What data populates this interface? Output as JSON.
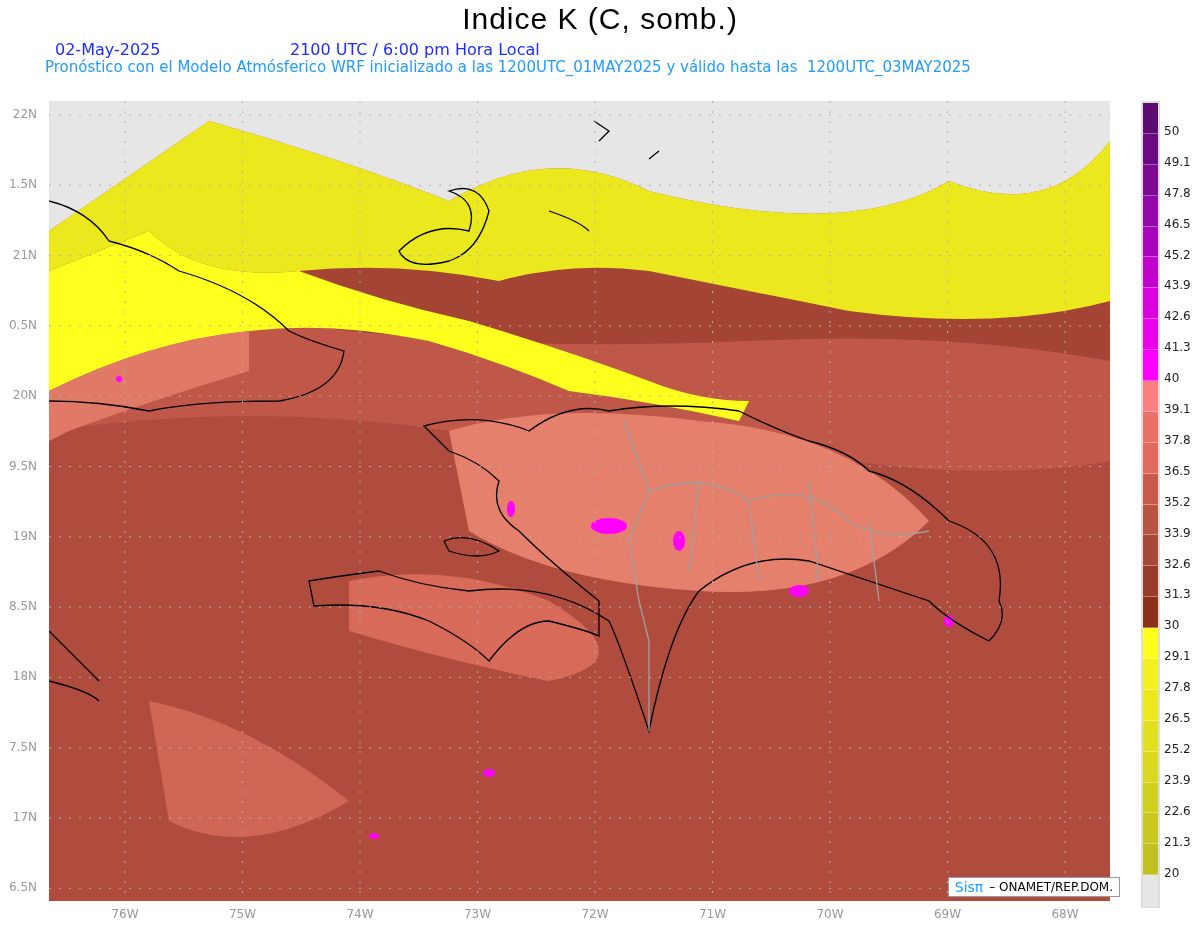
{
  "title": "Indice K (C, somb.)",
  "date": "02-May-2025",
  "time": "2100 UTC / 6:00 pm Hora Local",
  "subtitle": "Pronóstico con el Modelo Atmósferico WRF inicializado a las 1200UTC_01MAY2025 y válido hasta las  1200UTC_03MAY2025",
  "lat_labels": [
    "22N",
    "1.5N",
    "21N",
    "0.5N",
    "20N",
    "9.5N",
    "19N",
    "8.5N",
    "18N",
    "7.5N",
    "17N",
    "6.5N"
  ],
  "lon_labels": [
    "76W",
    "75W",
    "74W",
    "73W",
    "72W",
    "71W",
    "70W",
    "69W",
    "68W"
  ],
  "legend": [
    {
      "label": "50",
      "color": "#5e0d6e"
    },
    {
      "label": "49.1",
      "color": "#6b0b80"
    },
    {
      "label": "47.8",
      "color": "#7d0a92"
    },
    {
      "label": "46.5",
      "color": "#9209a8"
    },
    {
      "label": "45.2",
      "color": "#a806bb"
    },
    {
      "label": "43.9",
      "color": "#c004cc"
    },
    {
      "label": "42.6",
      "color": "#d803dc"
    },
    {
      "label": "41.3",
      "color": "#ea02ea"
    },
    {
      "label": "40",
      "color": "#ff00ff"
    },
    {
      "label": "39.1",
      "color": "#fa8080"
    },
    {
      "label": "37.8",
      "color": "#eb7068"
    },
    {
      "label": "36.5",
      "color": "#e06a5e"
    },
    {
      "label": "35.2",
      "color": "#c85a4c"
    },
    {
      "label": "33.9",
      "color": "#b85444"
    },
    {
      "label": "32.6",
      "color": "#a84838"
    },
    {
      "label": "31.3",
      "color": "#983c2c"
    },
    {
      "label": "30",
      "color": "#8a3218"
    },
    {
      "label": "29.1",
      "color": "#ffff1e"
    },
    {
      "label": "27.8",
      "color": "#f5f020"
    },
    {
      "label": "26.5",
      "color": "#ece81e"
    },
    {
      "label": "25.2",
      "color": "#e2e01e"
    },
    {
      "label": "23.9",
      "color": "#dad81e"
    },
    {
      "label": "22.6",
      "color": "#d0d020"
    },
    {
      "label": "21.3",
      "color": "#c8c820"
    },
    {
      "label": "20",
      "color": "#c0c020"
    },
    {
      "color": "#e6e6e6"
    }
  ],
  "credit": {
    "logo": "Sisπ",
    "text": "– ONAMET/REP.DOM."
  }
}
